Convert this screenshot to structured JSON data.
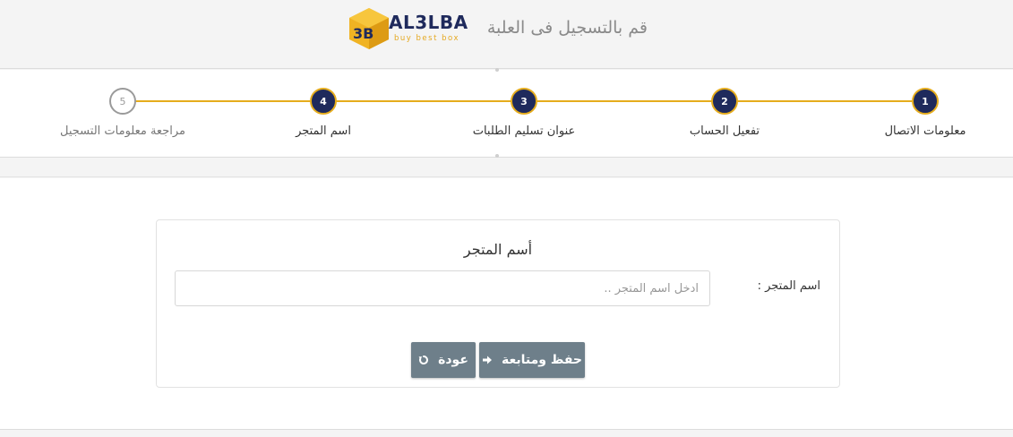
{
  "header": {
    "title": "قم بالتسجيل فى العلبة",
    "logo": {
      "brand": "AL3LBA",
      "tagline": "buy best box",
      "cube_letters": "3B"
    }
  },
  "stepper": {
    "steps": [
      {
        "number": "1",
        "label": "معلومات الاتصال",
        "state": "done"
      },
      {
        "number": "2",
        "label": "تفعيل الحساب",
        "state": "done"
      },
      {
        "number": "3",
        "label": "عنوان تسليم الطلبات",
        "state": "done"
      },
      {
        "number": "4",
        "label": "اسم المتجر",
        "state": "done"
      },
      {
        "number": "5",
        "label": "مراجعة معلومات التسجيل",
        "state": "pending"
      }
    ]
  },
  "form": {
    "title": "أسم المتجر",
    "store_name_label": "اسم المتجر :",
    "store_name_value": "",
    "store_name_placeholder": "ادخل اسم المتجر ..",
    "save_label": "حفظ ومتابعة",
    "back_label": "عودة"
  },
  "icons": {
    "save": "arrow-right-icon",
    "back": "refresh-icon"
  },
  "colors": {
    "accent": "#e5ac1d",
    "navy": "#1f2a5c",
    "button": "#6e7f8a"
  }
}
